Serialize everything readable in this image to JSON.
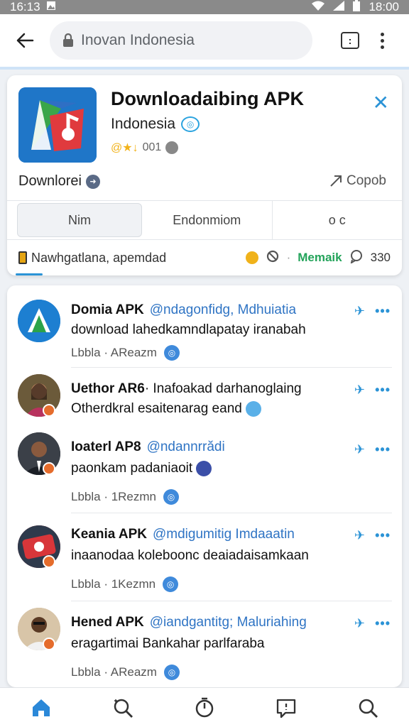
{
  "status_bar": {
    "time_left": "16:13",
    "time_right": "18:00"
  },
  "browser": {
    "url_text": "Inovan Indonesia"
  },
  "app_card": {
    "title": "Downloadaibing APK",
    "subtitle": "Indonesia",
    "rating_text": "001",
    "download_label": "Downlorei",
    "copy_label": "Copob",
    "segments": [
      "Nim",
      "Endonmiom",
      "o c"
    ],
    "footer_text": "Nawhgatlana, apemdad",
    "footer_label": "Memaik",
    "footer_count": "330"
  },
  "posts": [
    {
      "author": "Domia APK",
      "handle": "@ndagonfidg, Mdhuiatia",
      "body": "download lahedkamndlapatay iranabah",
      "meta": "Lbbla · AReazm"
    },
    {
      "author": "Uethor AR6",
      "handle": "· Inafoakad darhanoglaing",
      "body": "Otherdkral esaitenarag eand",
      "meta": ""
    },
    {
      "author": "Ioaterl AP8",
      "handle": "@ndannrrădi",
      "body": "paonkam padaniaoit",
      "meta": "Lbbla · 1Rezmn"
    },
    {
      "author": "Keania APK",
      "handle": "@mdigumitig Imdaaatin",
      "body": "inaanodaa koleboonc deaiadaisamkaan",
      "meta": "Lbbla · 1Kezmn"
    },
    {
      "author": "Hened APK",
      "handle": "@iandgantitg; Maluriahing",
      "body": "eragartimai Bankahar parlfaraba",
      "meta": "Lbbla · AReazm"
    }
  ],
  "colors": {
    "accent": "#2b93d6",
    "link": "#2f74c4",
    "icon_blue": "#1f76c8"
  },
  "nav": [
    "home-icon",
    "search-icon",
    "timer-icon",
    "message-icon",
    "search-icon"
  ]
}
